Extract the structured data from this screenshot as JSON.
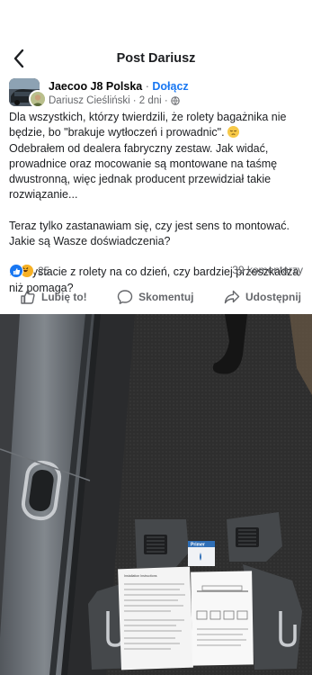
{
  "header": {
    "title": "Post Dariusz",
    "back_icon": "chevron-left-icon"
  },
  "post": {
    "group_name": "Jaecoo J8 Polska",
    "separator": "·",
    "join_label": "Dołącz",
    "author": "Dariusz Cieśliński",
    "time": "· 2 dni ·",
    "privacy_icon": "globe-icon",
    "paragraphs": [
      "Dla wszystkich, którzy twierdzili, że rolety bagażnika nie będzie, bo \"brakuje wytłoczeń i prowadnic\".",
      "Odebrałem od dealera fabryczny zestaw. Jak widać, prowadnice oraz mocowanie są montowane na taśmę dwustronną, więc jednak producent przewidział takie rozwiązanie...",
      "Teraz tylko zastanawiam się, czy jest sens to montować. Jakie są Wasze doświadczenia?",
      "Korzystacie z rolety na co dzień, czy bardziej przeszkadza niż pomaga?"
    ],
    "reactions_count": "25",
    "comments_count": "39 komentarzy"
  },
  "actions": {
    "like": "Lubię to!",
    "comment": "Skomentuj",
    "share": "Udostępnij"
  },
  "photo": {
    "package_brand": "Primer",
    "doc_heading": "Installation Instructions"
  },
  "colors": {
    "link_blue": "#1877f2",
    "secondary_text": "#65676b",
    "primary_text": "#1c1e21",
    "haha_yellow": "#f7b125"
  }
}
